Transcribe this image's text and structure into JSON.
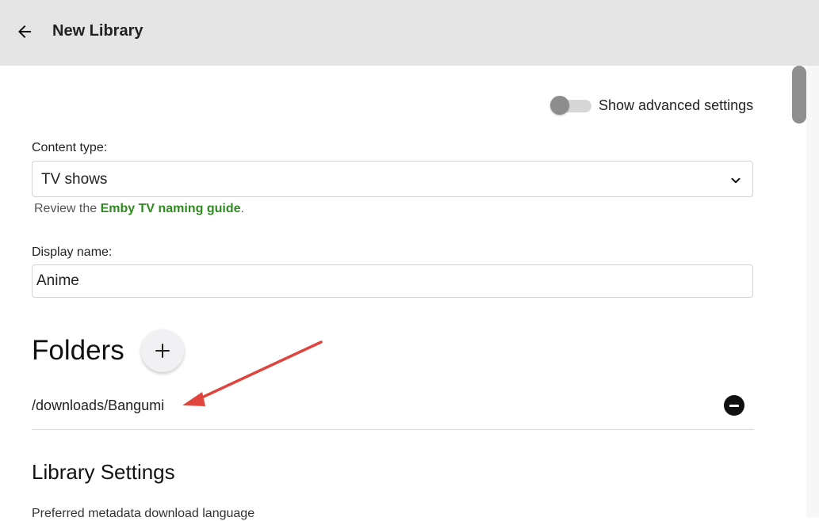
{
  "header": {
    "title": "New Library",
    "back_icon": "arrow-left-icon"
  },
  "advanced_settings": {
    "label": "Show advanced settings",
    "checked": false
  },
  "content_type": {
    "label": "Content type:",
    "selected": "TV shows",
    "hint_prefix": "Review the ",
    "hint_link": "Emby TV naming guide",
    "hint_suffix": "."
  },
  "display_name": {
    "label": "Display name:",
    "value": "Anime"
  },
  "folders": {
    "title": "Folders",
    "add_icon": "plus-icon",
    "items": [
      {
        "path": "/downloads/Bangumi",
        "remove_icon": "minus-circle-icon"
      }
    ]
  },
  "library_settings": {
    "title": "Library Settings",
    "partial_line": "Preferred metadata download language"
  },
  "annotation": {
    "color": "#e0443c"
  },
  "colors": {
    "header_bg": "#e5e5e5",
    "link": "#2e8b1f"
  }
}
